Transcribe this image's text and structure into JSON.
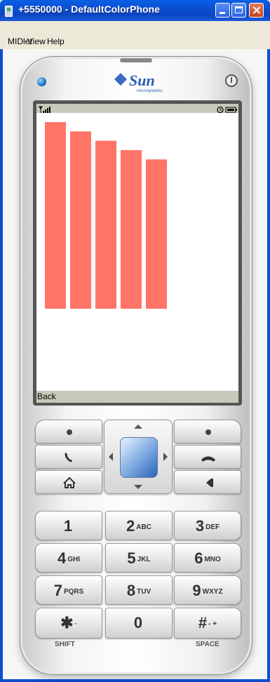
{
  "window": {
    "title": "+5550000 - DefaultColorPhone",
    "menu": [
      {
        "label": "MIDlet"
      },
      {
        "label": "View"
      },
      {
        "label": "Help"
      }
    ]
  },
  "phone": {
    "brand": "Sun",
    "brand_sub": "microsystems",
    "softkey_left": "Back",
    "keypad": [
      {
        "digit": "1",
        "letters": ""
      },
      {
        "digit": "2",
        "letters": "ABC"
      },
      {
        "digit": "3",
        "letters": "DEF"
      },
      {
        "digit": "4",
        "letters": "GHI"
      },
      {
        "digit": "5",
        "letters": "JKL"
      },
      {
        "digit": "6",
        "letters": "MNO"
      },
      {
        "digit": "7",
        "letters": "PQRS"
      },
      {
        "digit": "8",
        "letters": "TUV"
      },
      {
        "digit": "9",
        "letters": "WXYZ"
      },
      {
        "digit": "✱",
        "letters": "·"
      },
      {
        "digit": "0",
        "letters": ""
      },
      {
        "digit": "#",
        "letters": "- +"
      }
    ],
    "shift_label": "SHIFT",
    "space_label": "SPACE"
  },
  "chart_data": {
    "type": "bar",
    "values": [
      100,
      95,
      90,
      85,
      80
    ],
    "color": "#ff7466"
  },
  "colors": {
    "titlebar": "#0b4fd0",
    "bar": "#ff7466",
    "lcd_status": "#c9c9bb"
  }
}
